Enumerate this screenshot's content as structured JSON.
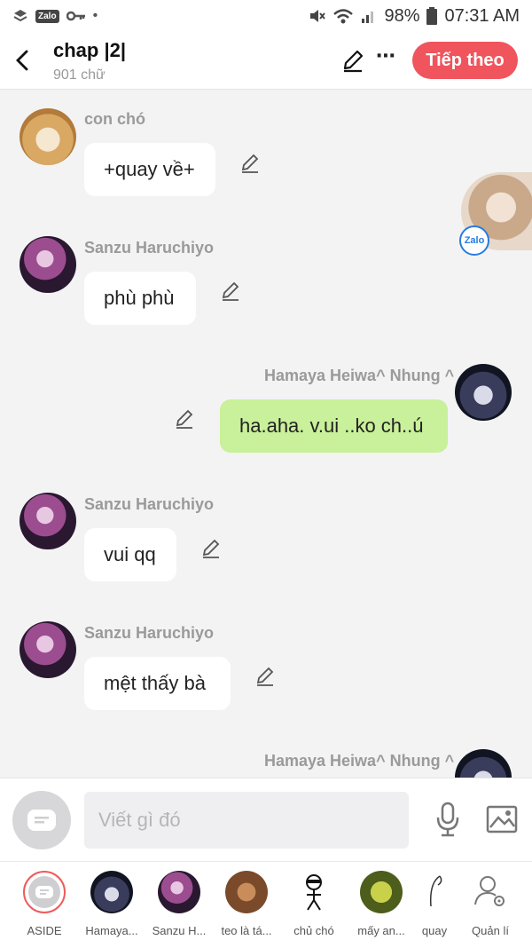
{
  "status_bar": {
    "battery": "98%",
    "time": "07:31 AM",
    "left_icons": [
      "layers-icon",
      "zalo-icon",
      "key-icon",
      "dot-icon"
    ],
    "zalo_label": "Zalo"
  },
  "header": {
    "title": "chap |2|",
    "subtitle": "901 chữ",
    "next_button": "Tiếp theo"
  },
  "messages": [
    {
      "sender": "con chó",
      "text": "+quay về+",
      "side": "left",
      "avatar": "dog"
    },
    {
      "sender": "Sanzu Haruchiyo",
      "text": "phù phù",
      "side": "left",
      "avatar": "sanzu"
    },
    {
      "sender": "Hamaya Heiwa^ Nhung ^",
      "text": "ha.aha. v.ui ..ko ch..ú",
      "side": "right",
      "avatar": "hamaya"
    },
    {
      "sender": "Sanzu Haruchiyo",
      "text": "vui qq",
      "side": "left",
      "avatar": "sanzu"
    },
    {
      "sender": "Sanzu Haruchiyo",
      "text": "mệt thấy bà",
      "side": "left",
      "avatar": "sanzu"
    },
    {
      "sender": "Hamaya Heiwa^ Nhung ^",
      "text": "",
      "side": "right",
      "avatar": "hamaya"
    }
  ],
  "floating_bubble": {
    "badge": "Zalo"
  },
  "composer": {
    "placeholder": "Viết gì đó"
  },
  "tabs": [
    {
      "label": "ASIDE",
      "avatar": "aside"
    },
    {
      "label": "Hamaya...",
      "avatar": "hamaya"
    },
    {
      "label": "Sanzu H...",
      "avatar": "sanzu"
    },
    {
      "label": "teo là tá...",
      "avatar": "teo"
    },
    {
      "label": "chủ chó",
      "avatar": "stickman"
    },
    {
      "label": "mấy an...",
      "avatar": "shrek"
    },
    {
      "label": "quay",
      "avatar": "sketch"
    },
    {
      "label": "Quản lí",
      "avatar": "manage"
    }
  ],
  "colors": {
    "accent": "#f0545d",
    "my_bubble": "#c9f09a",
    "background": "#f3f3f4"
  }
}
